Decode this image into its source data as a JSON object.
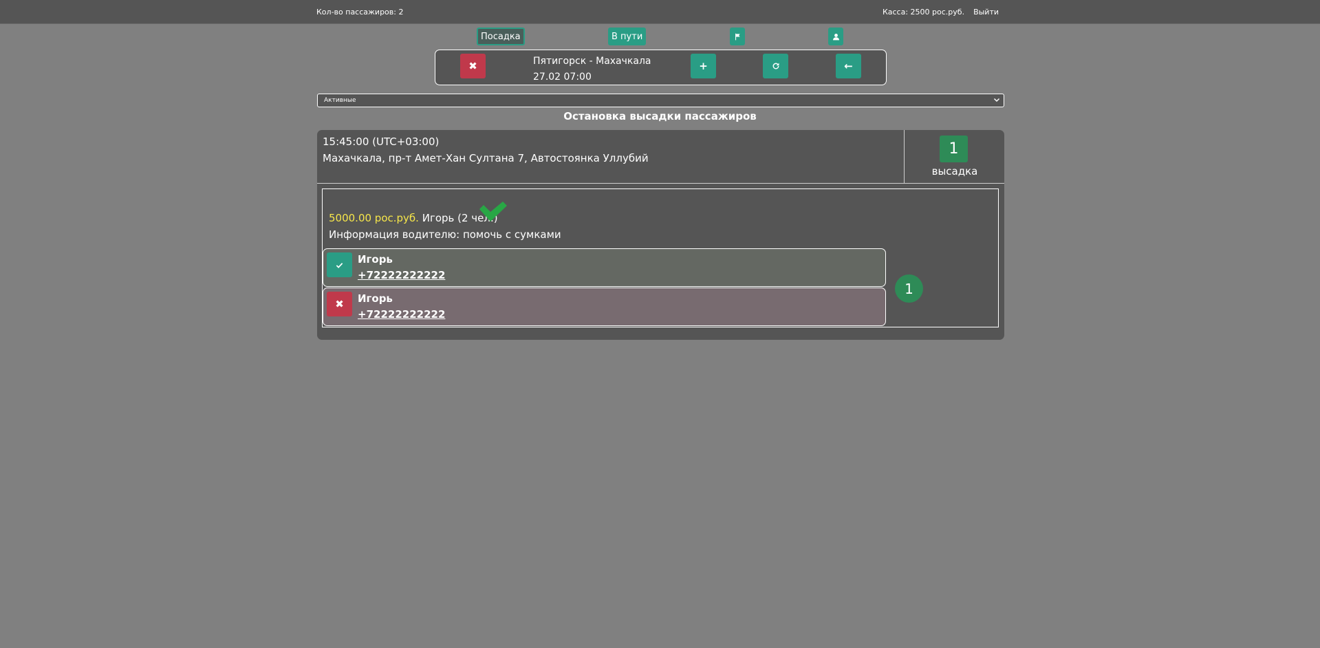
{
  "header": {
    "passenger_count": "Кол-во пассажиров: 2",
    "cash": "Касса: 2500 рос.руб.",
    "logout": "Выйти"
  },
  "tabs": {
    "boarding": "Посадка",
    "on_route": "В пути",
    "flag_icon": "flag-icon",
    "user_icon": "user-icon"
  },
  "trip": {
    "route": "Пятигорск - Махачкала",
    "datetime": "27.02 07:00"
  },
  "filter": {
    "selected": "Активные"
  },
  "section_title": "Остановка высадки пассажиров",
  "stop": {
    "time": "15:45:00 (UTC+03:00)",
    "address": "Махачкала, пр-т Амет-Хан Султана 7, Автостоянка Уллубий",
    "count": "1",
    "count_label": "высадка"
  },
  "order": {
    "price": "5000.00 рос.руб.",
    "client": "Игорь (2 чел.)",
    "info": "Информация водителю: помочь с сумками",
    "passengers": [
      {
        "name": "Игорь",
        "phone": "+72222222222",
        "status": "confirmed"
      },
      {
        "name": "Игорь",
        "phone": "+72222222222",
        "status": "cancelled"
      }
    ],
    "count": "1"
  },
  "colors": {
    "background": "#808080",
    "panel": "#555555",
    "accent_green": "#2a9d85",
    "danger_red": "#c0394b",
    "price_yellow": "#f6e64a"
  }
}
